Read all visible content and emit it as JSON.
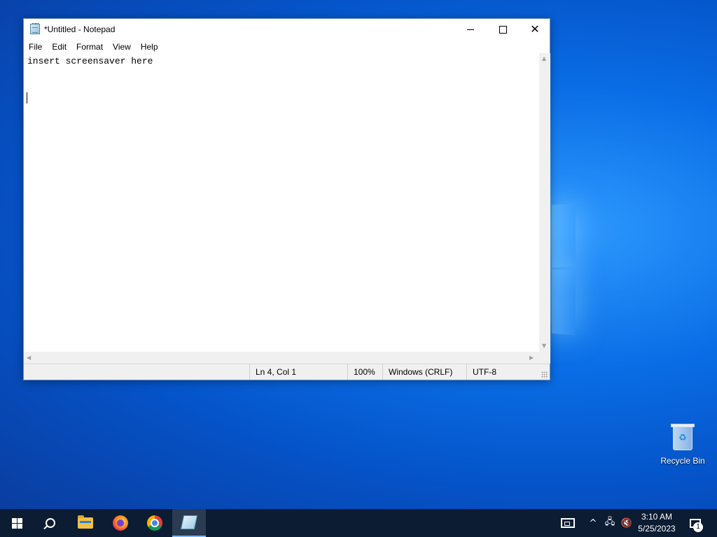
{
  "window": {
    "title": "*Untitled - Notepad",
    "minimize_icon": "minimize-icon",
    "maximize_icon": "maximize-icon",
    "close_glyph": "✕"
  },
  "menu": {
    "items": [
      "File",
      "Edit",
      "Format",
      "View",
      "Help"
    ]
  },
  "editor": {
    "content": "insert screensaver here"
  },
  "statusbar": {
    "position": "Ln 4, Col 1",
    "zoom": "100%",
    "line_ending": "Windows (CRLF)",
    "encoding": "UTF-8"
  },
  "desktop": {
    "recycle_bin_label": "Recycle Bin"
  },
  "taskbar": {
    "time": "3:10 AM",
    "date": "5/25/2023",
    "notification_count": "1",
    "chevron": "^"
  },
  "colors": {
    "desktop_accent": "#0a6ee6",
    "taskbar": "#0b1c33"
  }
}
